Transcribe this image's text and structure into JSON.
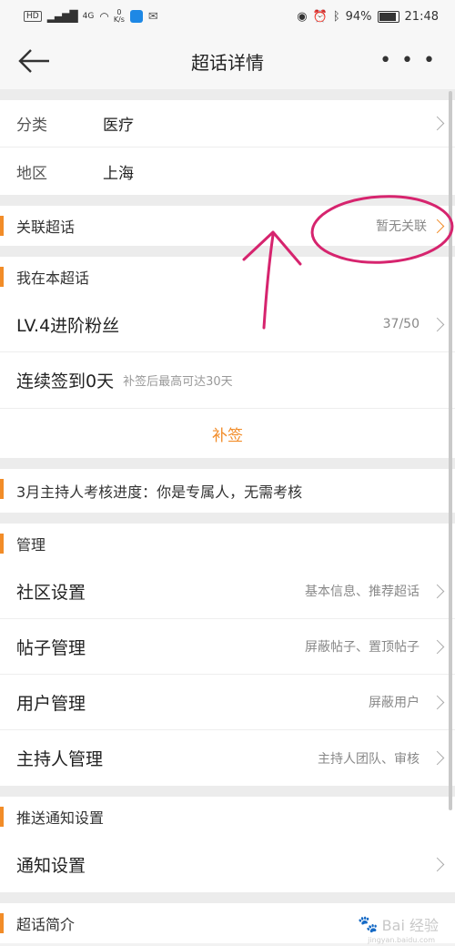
{
  "status_bar": {
    "hd": "HD",
    "network": "4G",
    "speed_value": "0",
    "speed_unit": "K/s",
    "battery": "94%",
    "time": "21:48"
  },
  "header": {
    "title": "超话详情",
    "more_label": "• • •"
  },
  "info": {
    "category_key": "分类",
    "category_value": "医疗",
    "region_key": "地区",
    "region_value": "上海"
  },
  "related": {
    "label": "关联超话",
    "value": "暂无关联"
  },
  "me": {
    "head": "我在本超话",
    "level_label": "LV.4进阶粉丝",
    "level_progress": "37/50",
    "checkin_label": "连续签到0天",
    "checkin_hint": "补签后最高可达30天",
    "buqian": "补签"
  },
  "assessment": {
    "text": "3月主持人考核进度：你是专属人，无需考核"
  },
  "manage": {
    "head": "管理",
    "items": [
      {
        "label": "社区设置",
        "hint": "基本信息、推荐超话"
      },
      {
        "label": "帖子管理",
        "hint": "屏蔽帖子、置顶帖子"
      },
      {
        "label": "用户管理",
        "hint": "屏蔽用户"
      },
      {
        "label": "主持人管理",
        "hint": "主持人团队、审核"
      }
    ]
  },
  "push": {
    "head": "推送通知设置",
    "item_label": "通知设置"
  },
  "intro": {
    "head": "超话简介"
  },
  "watermark": {
    "brand": "Bai 经验",
    "sub": "jingyan.baidu.com"
  },
  "colors": {
    "accent": "#f28c28",
    "annotation": "#d6246e"
  }
}
